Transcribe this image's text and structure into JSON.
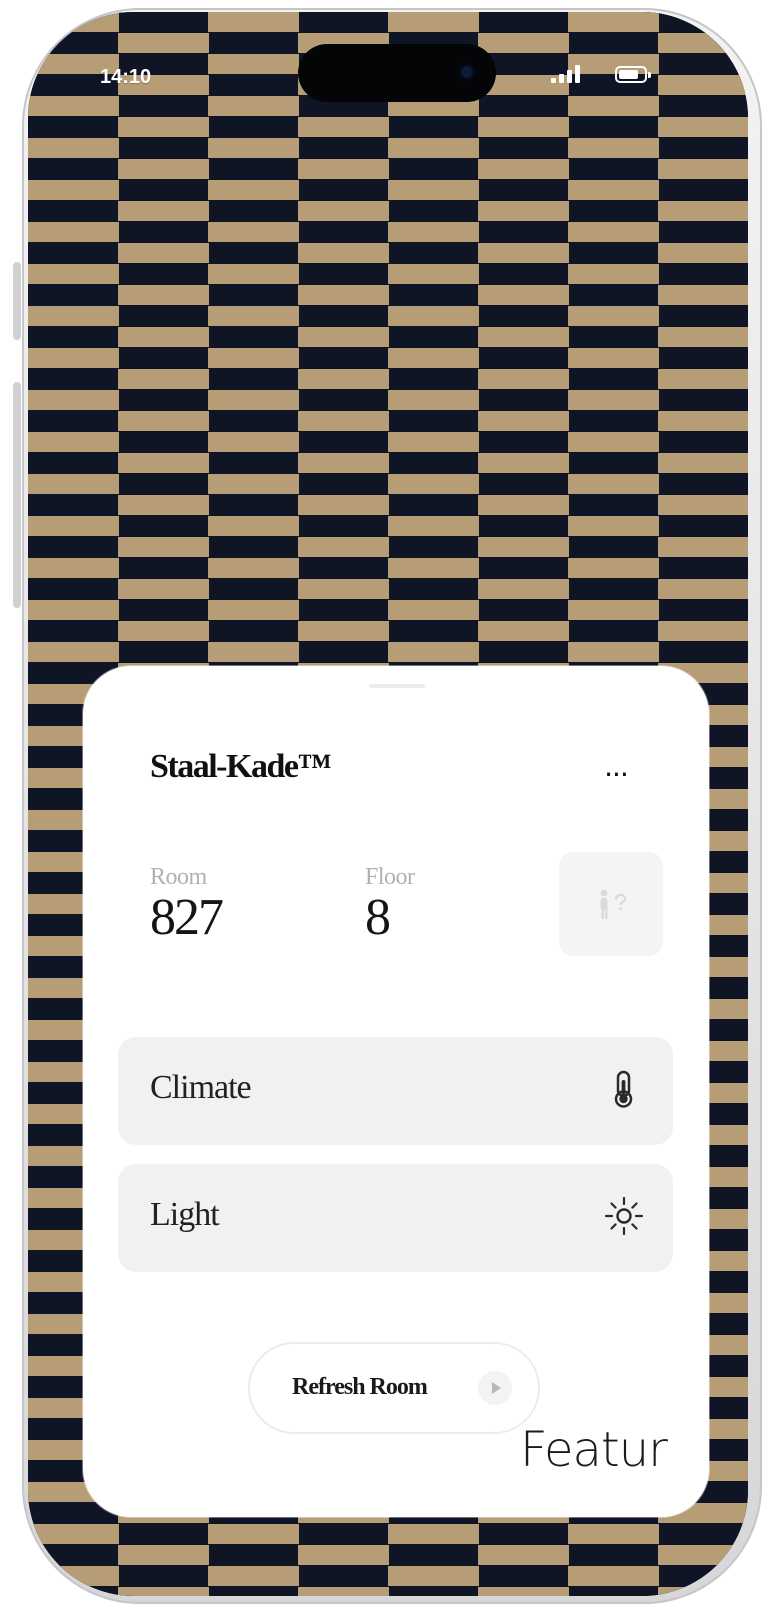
{
  "status_bar": {
    "time": "14:10",
    "signal_icon": "cellular-signal-icon",
    "battery_icon": "battery-icon"
  },
  "room_card": {
    "title": "Staal-Kade™",
    "more_label": "...",
    "room_label": "Room",
    "room_value": "827",
    "floor_label": "Floor",
    "floor_value": "8",
    "restroom_icon": "restroom-icon",
    "controls": [
      {
        "label": "Climate",
        "icon": "thermometer-icon"
      },
      {
        "label": "Light",
        "icon": "sun-icon"
      }
    ],
    "refresh_label": "Refresh Room",
    "refresh_icon": "play-icon"
  },
  "overlay_text": "Featur",
  "colors": {
    "wallpaper_gold": "#b79d76",
    "wallpaper_navy": "#101526",
    "card_background": "#ffffff",
    "control_background": "#f1f1f1",
    "text_primary": "#111111",
    "text_muted": "#b1b1b1"
  }
}
